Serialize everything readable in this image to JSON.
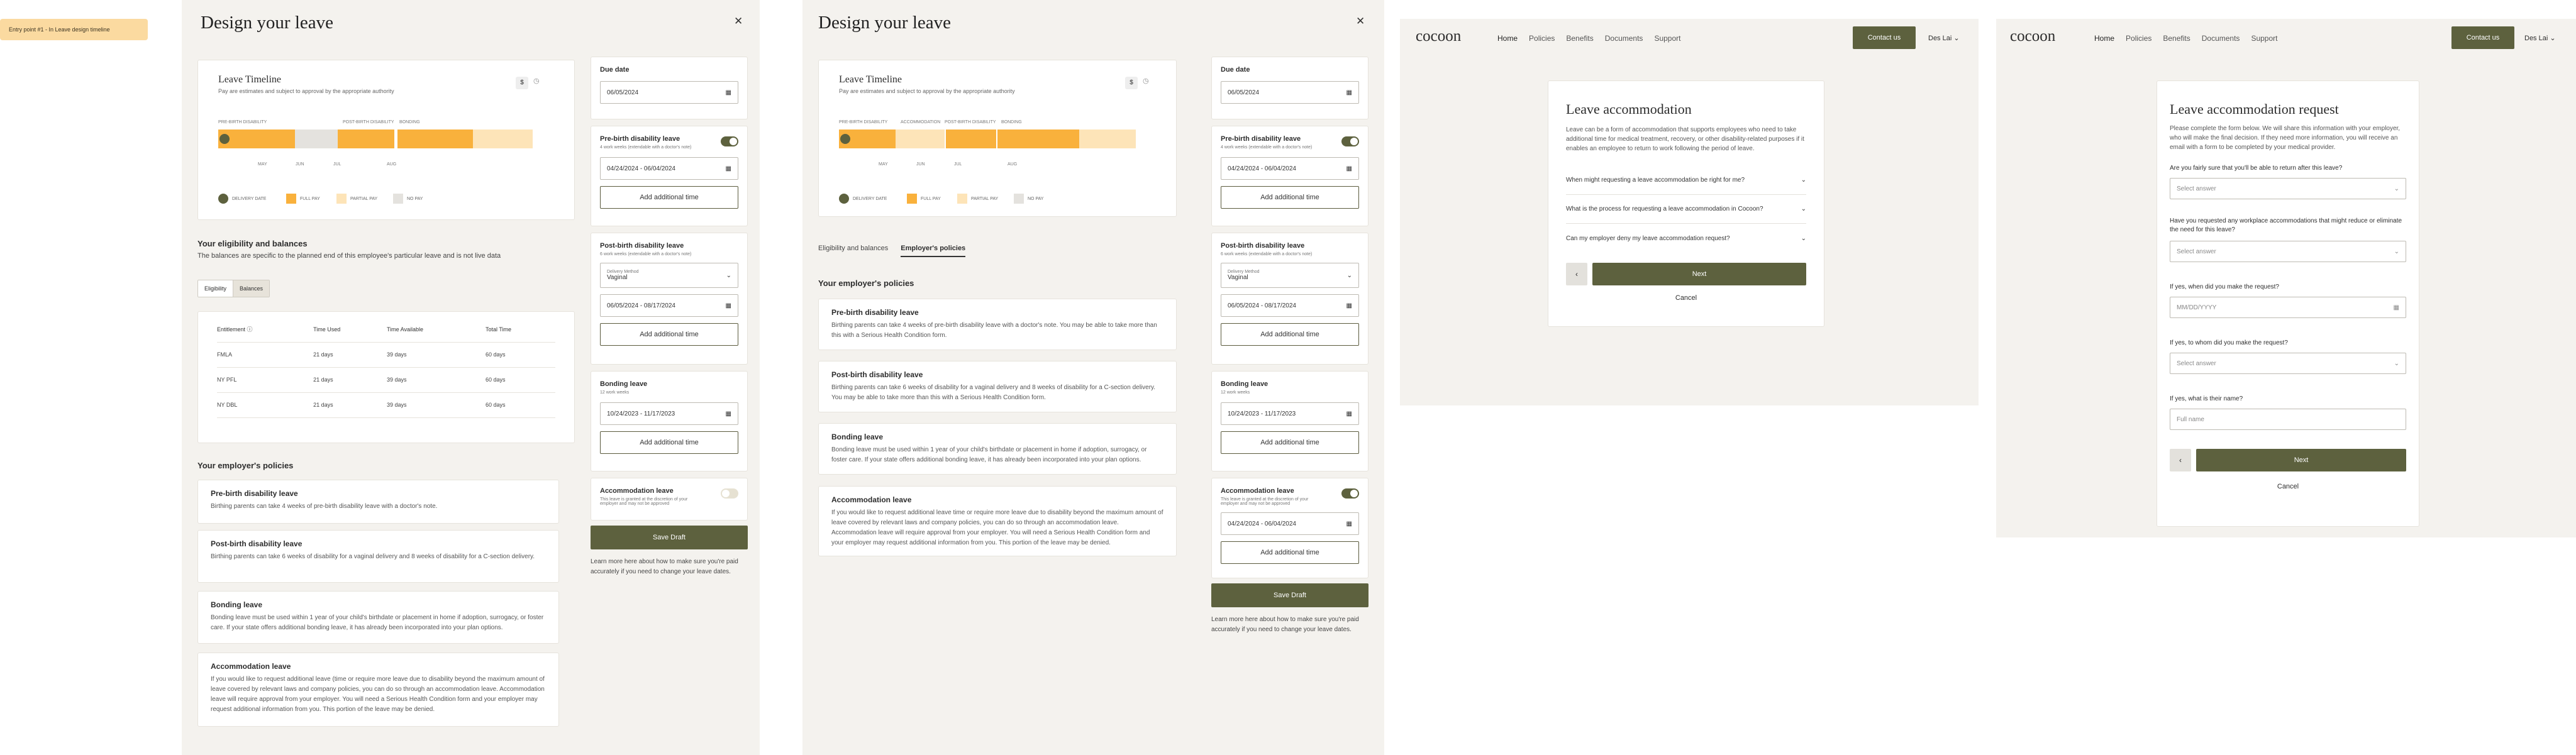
{
  "note": "Entry point #1 - In Leave design timeline",
  "dl": {
    "title": "Design your leave",
    "timeline": {
      "title": "Leave Timeline",
      "subtitle": "Pay are estimates and subject to approval by the appropriate authority",
      "seg_labels": [
        "PRE-BIRTH DISABILITY",
        "POST-BIRTH DISABILITY",
        "BONDING"
      ],
      "seg_labels_b": [
        "PRE-BIRTH DISABILITY",
        "ACCOMMODATION",
        "POST-BIRTH DISABILITY",
        "BONDING"
      ],
      "ticks": [
        "MAY",
        "JUN",
        "JUL",
        "AUG"
      ],
      "legend": [
        "DELIVERY DATE",
        "FULL PAY",
        "PARTIAL PAY",
        "NO PAY"
      ]
    },
    "eligibility": {
      "title": "Your eligibility and balances",
      "subtitle": "The balances are specific to the planned end of this employee's particular leave and is not live data",
      "tabs": [
        "Eligibility",
        "Balances"
      ],
      "headers": [
        "Entitlement",
        "Time Used",
        "Time Available",
        "Total Time"
      ],
      "rows": [
        [
          "FMLA",
          "21 days",
          "39 days",
          "60 days"
        ],
        [
          "NY PFL",
          "21 days",
          "39 days",
          "60 days"
        ],
        [
          "NY DBL",
          "21 days",
          "39 days",
          "60 days"
        ]
      ]
    },
    "tabs_b": [
      "Eligibility and balances",
      "Employer's policies"
    ],
    "policies": {
      "title": "Your employer's policies",
      "items": [
        {
          "title": "Pre-birth disability leave",
          "text": "Birthing parents can take 4 weeks of pre-birth disability leave with a doctor's note."
        },
        {
          "title": "Post-birth disability leave",
          "text": "Birthing parents can take 6 weeks of disability for a vaginal delivery and 8 weeks of disability for a C-section delivery."
        },
        {
          "title": "Bonding leave",
          "text": "Bonding leave must be used within 1 year of your child's birthdate or placement in home if adoption, surrogacy, or foster care. If your state offers additional bonding leave, it has already been incorporated into your plan options."
        },
        {
          "title": "Accommodation leave",
          "text": "If you would like to request additional leave (time or require more leave due to disability beyond the maximum amount of leave covered by relevant laws and company policies, you can do so through an accommodation leave. Accommodation leave will require approval from your employer. You will need a Serious Health Condition form and your employer may request additional information from you. This portion of the leave may be denied."
        }
      ],
      "items_b": [
        {
          "title": "Pre-birth disability leave",
          "text": "Birthing parents can take 4 weeks of pre-birth disability leave with a doctor's note. You may be able to take more than this with a Serious Health Condition form."
        },
        {
          "title": "Post-birth disability leave",
          "text": "Birthing parents can take 6 weeks of disability for a vaginal delivery and 8 weeks of disability for a C-section delivery. You may be able to take more than this with a Serious Health Condition form."
        },
        {
          "title": "Bonding leave",
          "text": "Bonding leave must be used within 1 year of your child's birthdate or placement in home if adoption, surrogacy, or foster care. If your state offers additional bonding leave, it has already been incorporated into your plan options."
        },
        {
          "title": "Accommodation leave",
          "text": "If you would like to request additional leave time or require more leave due to disability beyond the maximum amount of leave covered by relevant laws and company policies, you can do so through an accommodation leave. Accommodation leave will require approval from your employer. You will need a Serious Health Condition form and your employer may request additional information from you. This portion of the leave may be denied."
        }
      ]
    },
    "side": {
      "due_label": "Due date",
      "due_value": "06/05/2024",
      "pre_label": "Pre-birth disability leave",
      "pre_sub": "4 work weeks (extendable with a doctor's note)",
      "pre_range": "04/24/2024 - 06/04/2024",
      "add": "Add additional time",
      "post_label": "Post-birth disability leave",
      "post_sub": "6 work weeks (extendable with a doctor's note)",
      "delivery_label": "Delivery Method",
      "delivery_value": "Vaginal",
      "post_range": "06/05/2024 - 08/17/2024",
      "bond_label": "Bonding leave",
      "bond_sub": "12 work weeks",
      "bond_range": "10/24/2023 - 11/17/2023",
      "acc_label": "Accommodation leave",
      "acc_sub": "This leave is granted at the discretion of your employer and may not be approved",
      "acc_range": "04/24/2024 - 06/04/2024",
      "save": "Save Draft",
      "learn": "Learn more here about how to make sure you're paid accurately if you need to change your leave dates."
    }
  },
  "cocoon": {
    "logo": "cocoon",
    "nav": [
      "Home",
      "Policies",
      "Benefits",
      "Documents",
      "Support"
    ],
    "contact": "Contact us",
    "user": "Des Lai",
    "acc_title": "Leave accommodation",
    "acc_intro": "Leave can be a form of accommodation that supports employees who need to take additional time for medical treatment, recovery, or other disability-related purposes if it enables an employee to return to work following the period of leave.",
    "faqs": [
      "When might requesting a leave accommodation be right for me?",
      "What is the process for requesting a leave accommodation in Cocoon?",
      "Can my employer deny my leave accommodation request?"
    ],
    "back": "‹",
    "next": "Next",
    "cancel": "Cancel",
    "req_title": "Leave accommodation request",
    "req_intro": "Please complete the form below. We will share this information with your employer, who will make the final decision. If they need more information, you will receive an email with a form to be completed by your medical provider.",
    "q1": "Are you fairly sure that you'll be able to return after this leave?",
    "q2": "Have you requested any workplace accommodations that might reduce or eliminate the need for this leave?",
    "q3": "If yes, when did you make the request?",
    "q4": "If yes, to whom did you make the request?",
    "q5": "If yes, what is their name?",
    "select_ph": "Select answer",
    "date_ph": "MM/DD/YYYY",
    "name_ph": "Full name"
  }
}
